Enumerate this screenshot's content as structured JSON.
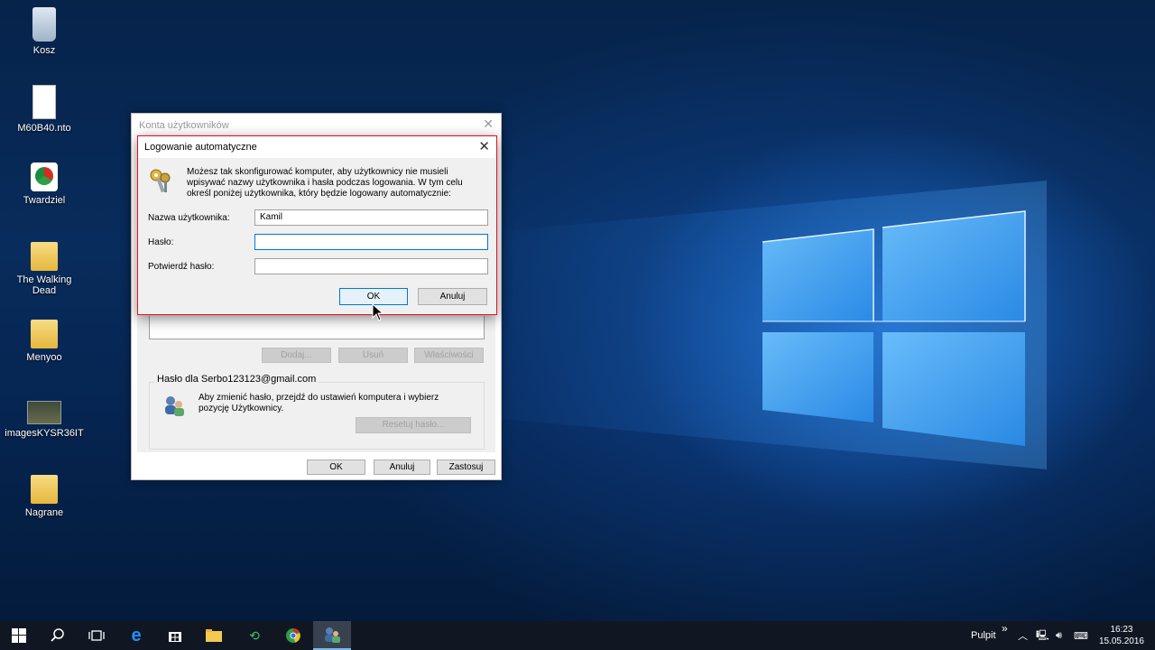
{
  "desktop": {
    "icons": [
      {
        "label": "Kosz",
        "icon": "recycle-bin-icon"
      },
      {
        "label": "M60B40.nto",
        "icon": "file-icon"
      },
      {
        "label": "Twardziel",
        "icon": "app-icon"
      },
      {
        "label": "The Walking Dead",
        "icon": "folder-icon"
      },
      {
        "label": "Menyoo",
        "icon": "folder-icon"
      },
      {
        "label": "imagesKYSR36IT",
        "icon": "image-icon"
      },
      {
        "label": "Nagrane",
        "icon": "folder-icon"
      }
    ]
  },
  "back_window": {
    "title": "Konta użytkowników",
    "buttons": {
      "add": "Dodaj...",
      "remove": "Usuń",
      "properties": "Właściwości"
    },
    "password_group_title": "Hasło dla Serbo123123@gmail.com",
    "password_text": "Aby zmienić hasło, przejdź do ustawień komputera i wybierz pozycję Użytkownicy.",
    "reset_button": "Resetuj hasło...",
    "ok": "OK",
    "cancel": "Anuluj",
    "apply": "Zastosuj"
  },
  "dialog": {
    "title": "Logowanie automatyczne",
    "description": "Możesz tak skonfigurować komputer, aby użytkownicy nie musieli wpisywać nazwy użytkownika i hasła podczas logowania. W tym celu określ poniżej użytkownika, który będzie logowany automatycznie:",
    "username_label": "Nazwa użytkownika:",
    "username_value": "Kamil",
    "password_label": "Hasło:",
    "password_value": "",
    "confirm_label": "Potwierdź hasło:",
    "confirm_value": "",
    "ok": "OK",
    "cancel": "Anuluj"
  },
  "taskbar": {
    "desktop_label": "Pulpit",
    "overflow": "»",
    "time": "16:23",
    "date": "15.05.2016"
  },
  "colors": {
    "accent": "#0078d7",
    "dialog_border": "#e81123",
    "taskbar": "#101722"
  }
}
